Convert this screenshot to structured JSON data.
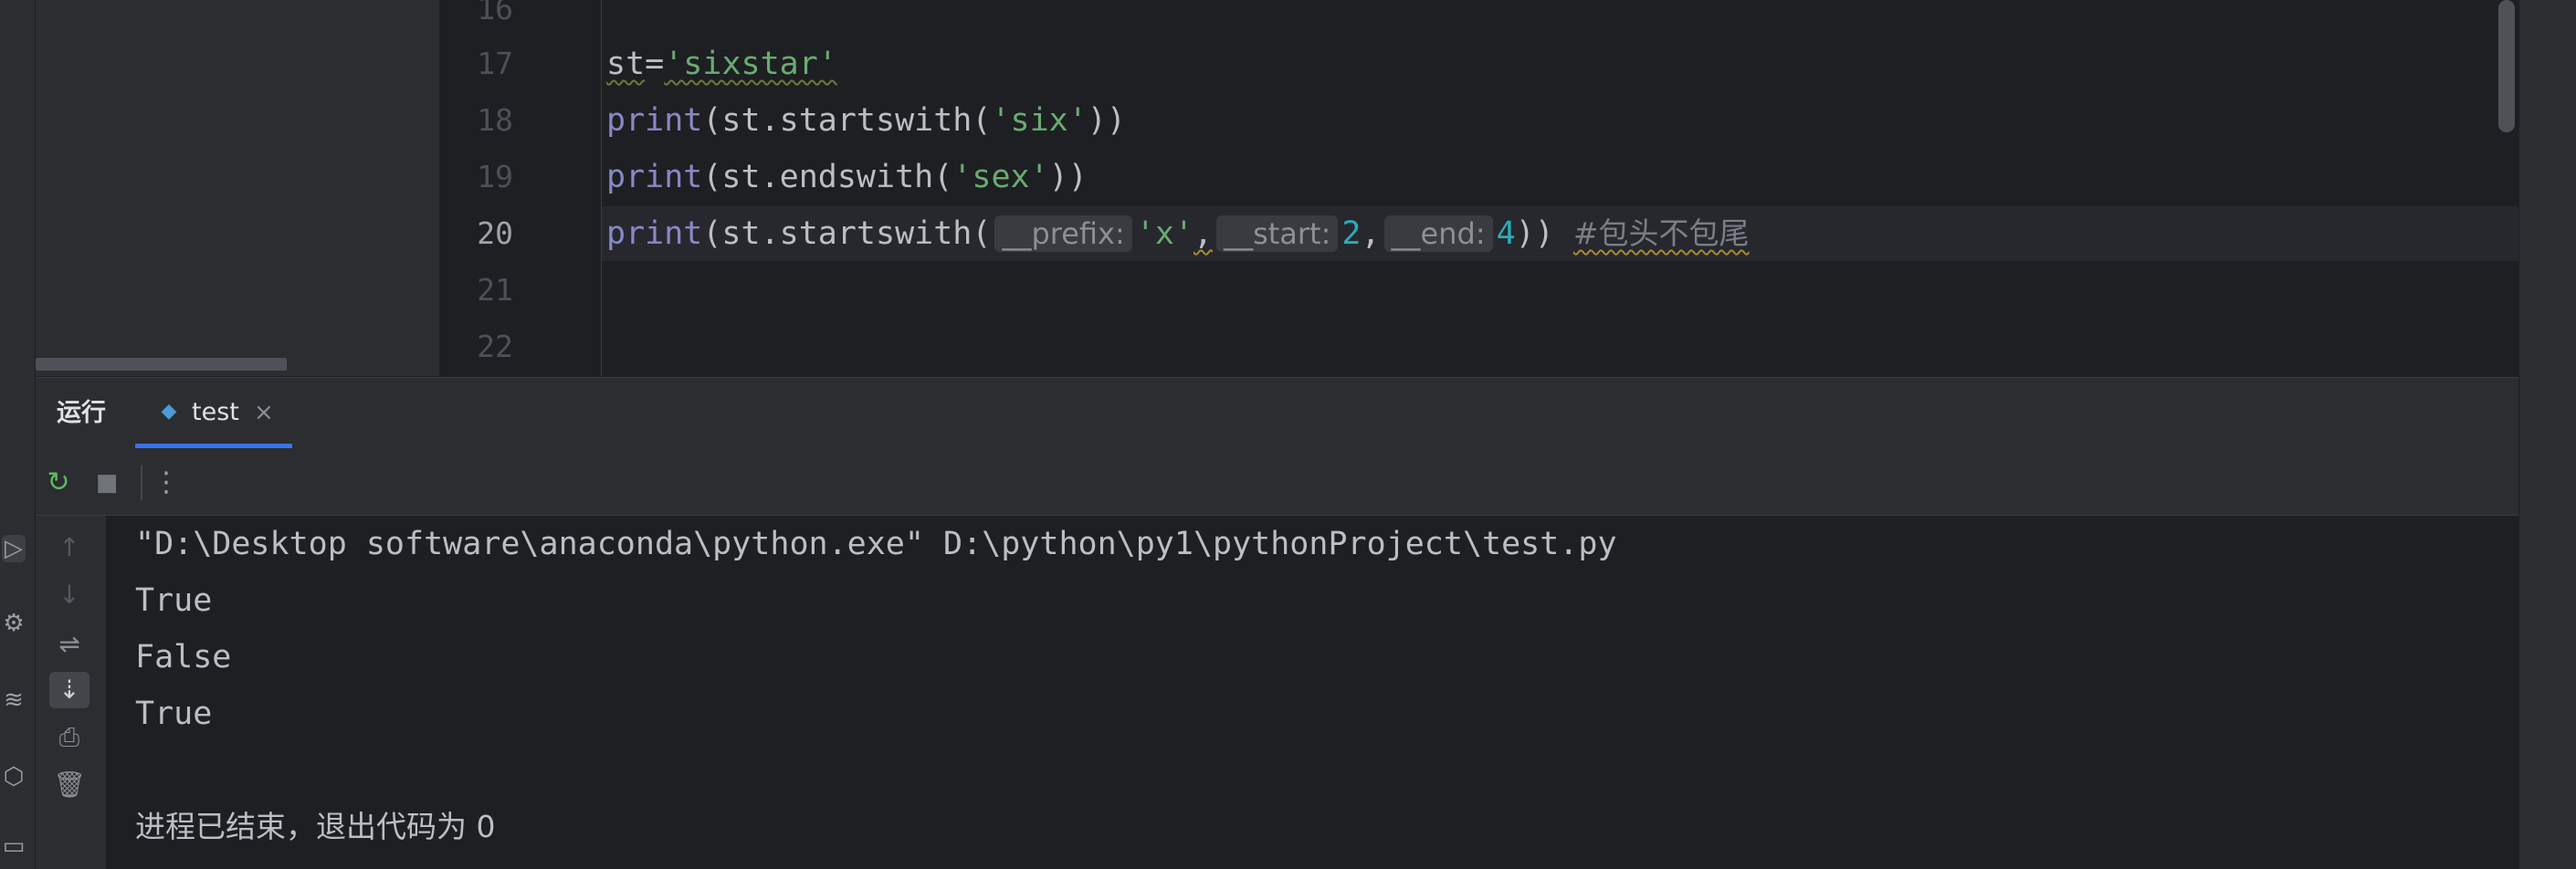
{
  "editor": {
    "lines": [
      {
        "no": "16"
      },
      {
        "no": "17",
        "var": "st",
        "op": "=",
        "str": "'sixstar'"
      },
      {
        "no": "18",
        "fn": "print",
        "open": "(st.startswith(",
        "str": "'six'",
        "close": "))"
      },
      {
        "no": "19",
        "fn": "print",
        "open": "(st.endswith(",
        "str": "'sex'",
        "close": "))"
      },
      {
        "no": "20",
        "fn": "print",
        "open": "(st.startswith(",
        "hint1": "__prefix:",
        "arg1": "'x'",
        "comma1": ",",
        "hint2": "__start:",
        "arg2": "2",
        "comma2": ",",
        "hint3": "__end:",
        "arg3": "4",
        "close": "))",
        "comment": "#包头不包尾"
      },
      {
        "no": "21"
      },
      {
        "no": "22"
      }
    ]
  },
  "run_panel": {
    "title": "运行",
    "tab": {
      "label": "test",
      "close": "×",
      "icon": "python-icon"
    },
    "toolbar": {
      "rerun_icon": "rerun-icon",
      "stop_icon": "stop-icon",
      "more_icon": "more-vertical-icon"
    },
    "side_icons": [
      "arrow-up-icon",
      "arrow-down-icon",
      "soft-wrap-icon",
      "scroll-to-end-icon",
      "print-icon",
      "trash-icon"
    ],
    "output": [
      "\"D:\\Desktop software\\anaconda\\python.exe\" D:\\python\\py1\\pythonProject\\test.py",
      "True",
      "False",
      "True",
      "",
      "进程已结束，退出代码为 0"
    ]
  },
  "colors": {
    "background": "#1e1f22",
    "panel": "#2b2d30",
    "keyword": "#8888c6",
    "string": "#6aab73",
    "number": "#2aacb8",
    "accent": "#3574f0"
  }
}
